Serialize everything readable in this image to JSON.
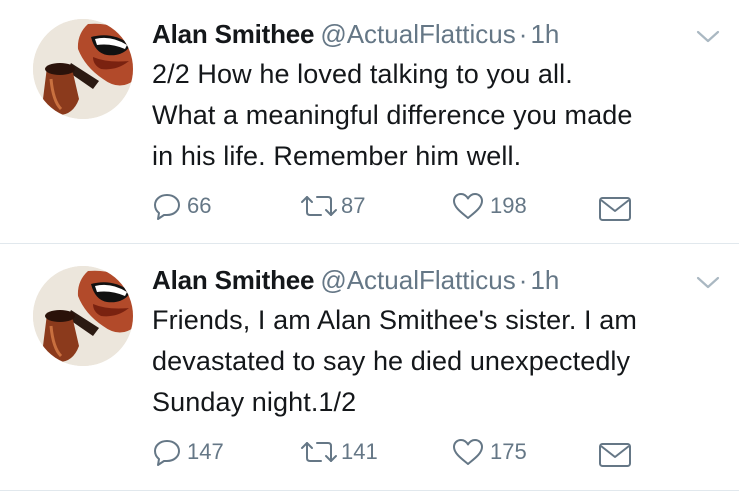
{
  "tweets": [
    {
      "author_name": "Alan Smithee",
      "handle": "@ActualFlatticus",
      "separator": "·",
      "time": "1h",
      "text": "2/2 How he loved talking to you all.\nWhat a meaningful difference you made\nin his life. Remember him well.",
      "replies": "66",
      "retweets": "87",
      "likes": "198"
    },
    {
      "author_name": "Alan Smithee",
      "handle": "@ActualFlatticus",
      "separator": "·",
      "time": "1h",
      "text": "Friends, I am Alan Smithee's sister. I am\ndevastated to say he died unexpectedly\nSunday night.1/2",
      "replies": "147",
      "retweets": "141",
      "likes": "175"
    }
  ],
  "icons": {
    "reply": "reply-icon",
    "retweet": "retweet-icon",
    "like": "heart-icon",
    "message": "envelope-icon",
    "menu": "chevron-down-icon",
    "avatar": "pipe-smoking-mouth-avatar"
  },
  "colors": {
    "text": "#14171a",
    "secondary": "#657786",
    "divider": "#e1e8ed",
    "caret": "#aab8c2"
  }
}
